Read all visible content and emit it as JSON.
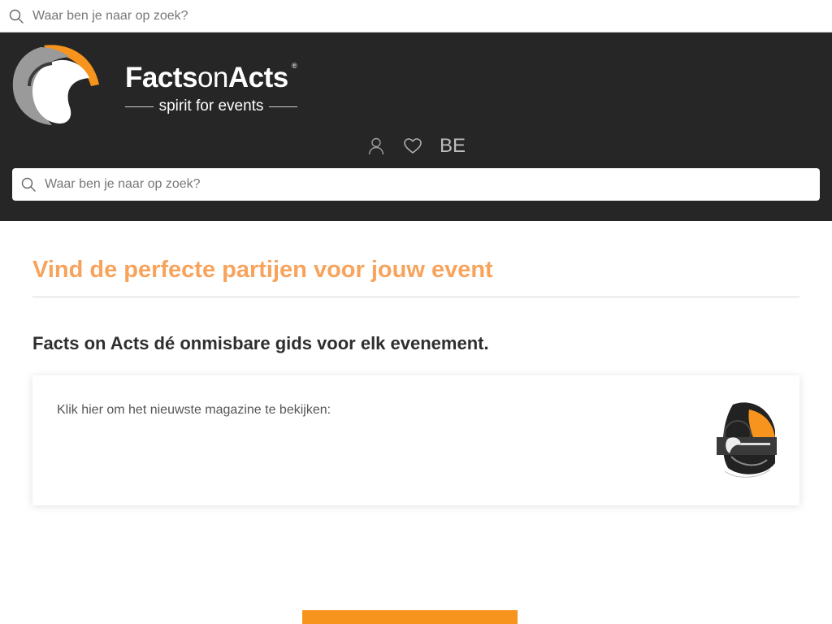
{
  "top_search": {
    "placeholder": "Waar ben je naar op zoek?",
    "icon": "search-icon"
  },
  "header": {
    "brand": {
      "part1": "Facts",
      "part2": "on",
      "part3": "Acts",
      "registered": "®",
      "tagline": "spirit for events"
    },
    "actions": {
      "user_icon": "user-icon",
      "heart_icon": "heart-icon",
      "language": "BE"
    },
    "search": {
      "placeholder": "Waar ben je naar op zoek?",
      "icon": "search-icon"
    }
  },
  "main": {
    "headline": "Vind de perfecte partijen voor jouw event",
    "subheadline": "Facts on Acts dé onmisbare gids voor elk evenement.",
    "magazine_card": {
      "text": "Klik hier om het nieuwste magazine te bekijken:"
    }
  },
  "colors": {
    "header_bg": "#262626",
    "accent_orange": "#f7a35c",
    "button_orange": "#f7941d"
  }
}
